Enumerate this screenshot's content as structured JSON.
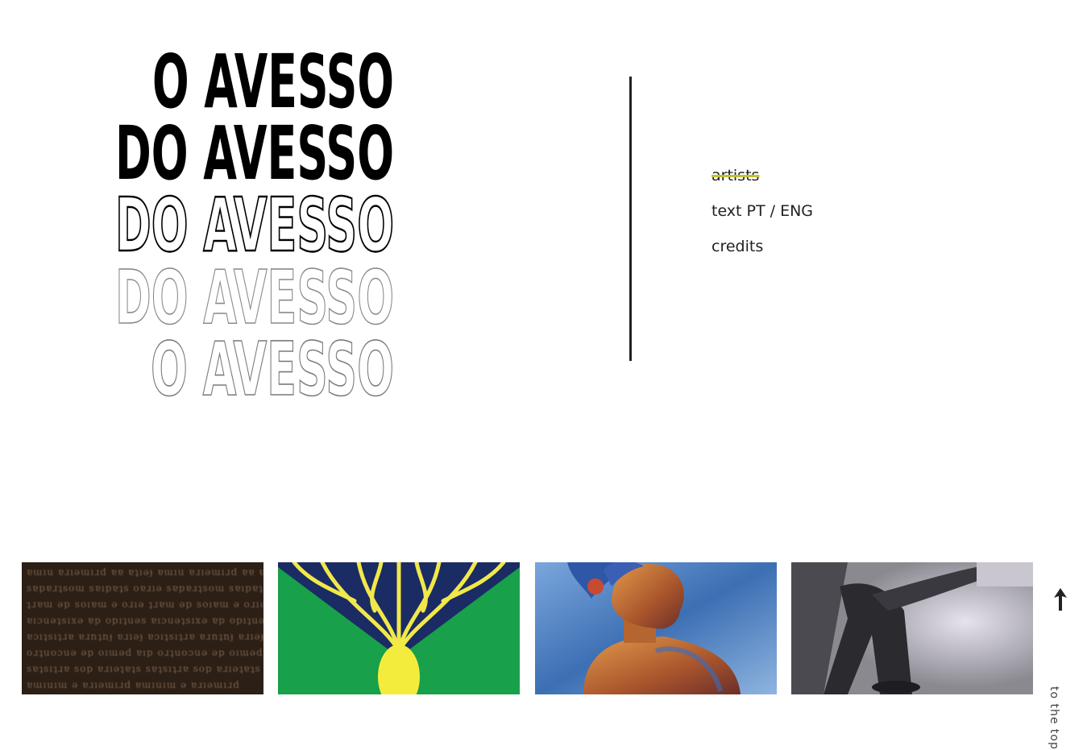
{
  "logo": {
    "lines": [
      "O AVESSO",
      "DO AVESSO",
      "DO AVESSO",
      "DO AVESSO",
      "O AVESSO"
    ]
  },
  "nav": {
    "items": [
      {
        "label": "artists",
        "active": true
      },
      {
        "label": "text PT / ENG",
        "active": false
      },
      {
        "label": "credits",
        "active": false
      }
    ],
    "accent_color": "#bfc233"
  },
  "gallery": {
    "tiles": [
      {
        "name": "tile-text-photo",
        "lines": [
          "ɐɯıu ɐɹıǝɯıɹd ɐɐ ɐʇıǝɟ",
          "sɐpɐɹʇsoɯ sɐıpɐʇs oɐɹıǝ",
          "ʇɹɐɯ ǝp soıɐɯ ǝ oɹıǝ",
          "ɐıɔuǝʇsıxǝ ɐp opıʇuǝs",
          "ɐɔıʇsıʇɹɐ ɐɹnʇnɟ ɐɹıǝɟ",
          "oɹʇuoɔuǝ ǝp oıɯǝd ɐıp",
          "sɐʇsıʇɹɐ sop ɐɹıǝʇɐʇs",
          "ɐɯıuıɯ ǝ ɐɹıǝɯıɹd"
        ]
      },
      {
        "name": "tile-flag-graphic"
      },
      {
        "name": "tile-statue-collage"
      },
      {
        "name": "tile-figure-photo"
      }
    ]
  },
  "to_top": {
    "label": "to the top",
    "icon": "arrow-up-icon"
  }
}
